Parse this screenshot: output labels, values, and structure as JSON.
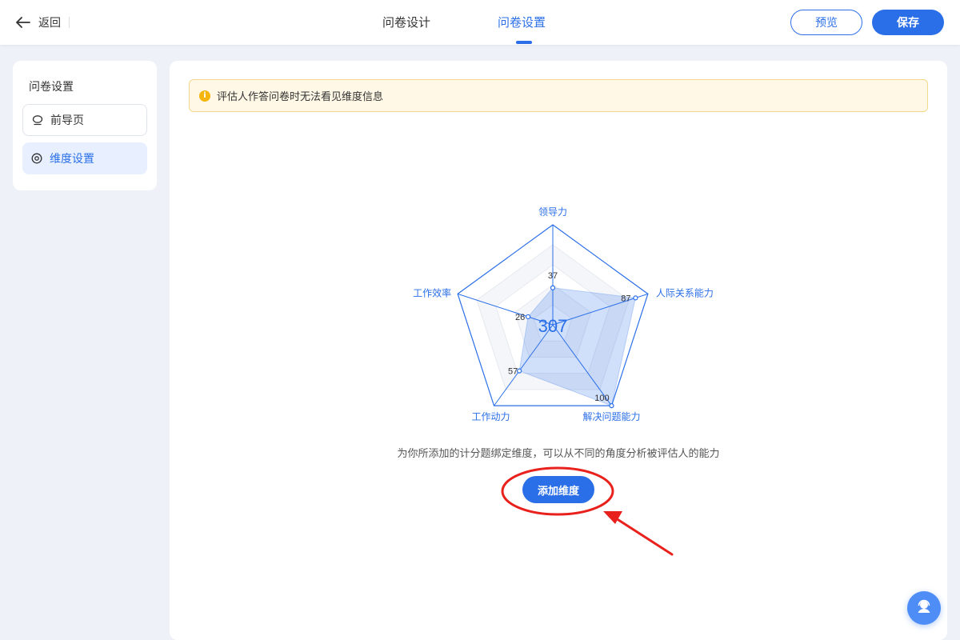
{
  "header": {
    "back_label": "返回",
    "tabs": [
      {
        "label": "问卷设计",
        "active": false
      },
      {
        "label": "问卷设置",
        "active": true
      }
    ],
    "preview_label": "预览",
    "save_label": "保存"
  },
  "sidebar": {
    "title": "问卷设置",
    "items": [
      {
        "label": "前导页",
        "icon": "chat-bubble-icon",
        "active": false
      },
      {
        "label": "维度设置",
        "icon": "target-icon",
        "active": true
      }
    ]
  },
  "main": {
    "notice": "评估人作答问卷时无法看见维度信息",
    "description": "为你所添加的计分题绑定维度，可以从不同的角度分析被评估人的能力",
    "add_button_label": "添加维度"
  },
  "colors": {
    "primary": "#2b6fe8",
    "warning": "#f5b50a",
    "annotation": "#e8211c"
  },
  "chart_data": {
    "type": "radar",
    "center_value": "307",
    "indicators": [
      "领导力",
      "人际关系能力",
      "解决问题能力",
      "工作动力",
      "工作效率"
    ],
    "values": [
      37,
      87,
      100,
      57,
      26
    ],
    "max": 100
  }
}
